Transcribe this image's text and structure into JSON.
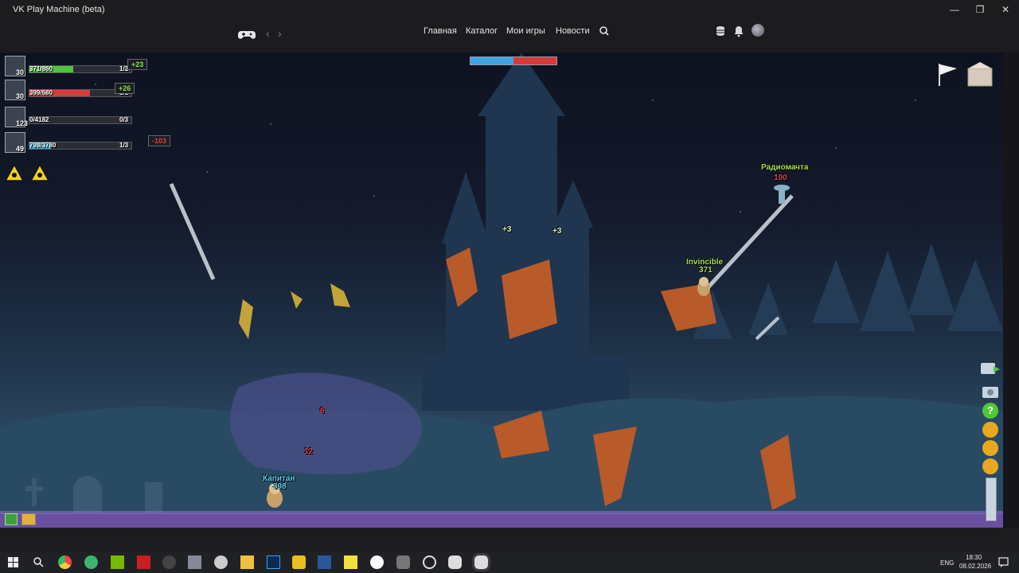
{
  "window": {
    "title": "VK Play Machine (beta)",
    "minimize_icon": "minimize-icon",
    "restore_icon": "restore-icon",
    "close_icon": "close-icon"
  },
  "nav": {
    "links": [
      "Главная",
      "Каталог",
      "Мои игры",
      "Новости"
    ],
    "icons": [
      "gamepad-logo-icon",
      "back-arrow-icon",
      "forward-arrow-icon",
      "search-icon",
      "storage-icon",
      "bell-icon",
      "user-avatar"
    ]
  },
  "hud": {
    "teams": [
      {
        "level": "30",
        "hp": "371/860",
        "count": "1/2",
        "fill": 0.43,
        "color": "#4fc73a",
        "delta": "+23",
        "delta_color": "#8fe04a"
      },
      {
        "level": "30",
        "hp": "399/680",
        "count": "1/1",
        "fill": 0.59,
        "color": "#d83a3a",
        "delta": "+26",
        "delta_color": "#8fe04a"
      },
      {
        "level": "123",
        "hp": "0/4182",
        "count": "0/3",
        "fill": 0.0,
        "color": "#3a6fd8",
        "delta": "",
        "delta_color": "#8fe04a"
      },
      {
        "level": "49",
        "hp": "798/3780",
        "count": "1/3",
        "fill": 0.21,
        "color": "#3ab3e0",
        "delta": "-103",
        "delta_color": "#e04040"
      }
    ],
    "wind": {
      "left_fraction": 0.5,
      "right_fraction": 0.5
    }
  },
  "game": {
    "labels": {
      "radio_tower": "Радиомачта",
      "radio_tower_hp": "100",
      "invincible": "Invincible",
      "invincible_hp": "371",
      "bonus_a": "+3",
      "bonus_b": "+3",
      "player_name": "Капитан",
      "player_hp": "398",
      "damage_a": "6",
      "damage_b": "12"
    },
    "colors": {
      "player_label": "#5fd3f0",
      "enemy_label": "#a8e04a",
      "radio_label": "#a8e04a",
      "damage": "#e04050"
    }
  },
  "taskbar": {
    "icons": [
      "windows-start-icon",
      "search-icon",
      "chrome-icon",
      "whatsapp-icon",
      "nvidia-icon",
      "msi-icon",
      "steam-like-icon",
      "app-icon",
      "settings-icon",
      "files-icon",
      "photoshop-icon",
      "app-triangle-icon",
      "word-icon",
      "yellow-app-icon",
      "yandex-icon",
      "app-hex-icon",
      "app-lens-icon",
      "gamepad-icon",
      "vk-play-icon"
    ],
    "tray": {
      "lang": "ENG",
      "time": "18:30",
      "date": "08.02.2026"
    }
  }
}
